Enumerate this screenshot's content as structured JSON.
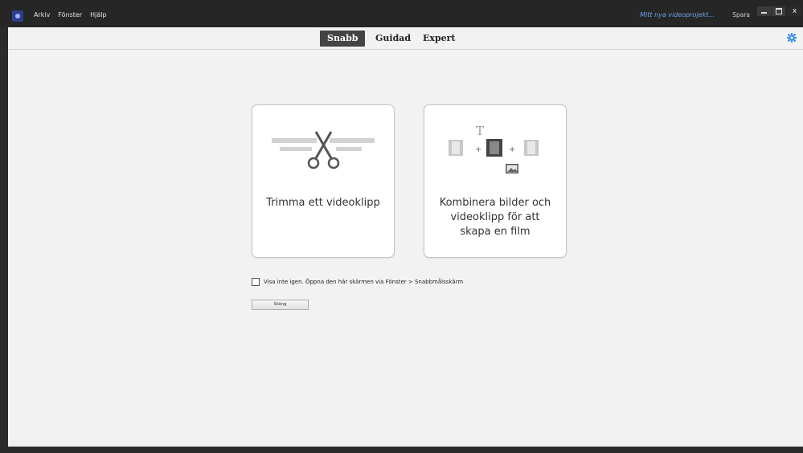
{
  "menu": {
    "items": [
      "Arkiv",
      "Fönster",
      "Hjälp"
    ]
  },
  "project": {
    "name": "Mitt nya videoprojekt...",
    "save_label": "Spara"
  },
  "window_controls": {
    "close_glyph": "x"
  },
  "tabs": [
    {
      "label": "Snabb",
      "active": true
    },
    {
      "label": "Guidad",
      "active": false
    },
    {
      "label": "Expert",
      "active": false
    }
  ],
  "cards": {
    "trim": {
      "label": "Trimma ett videoklipp",
      "icon": "scissors-icon"
    },
    "combine": {
      "label": "Kombinera bilder och videoklipp för att skapa en film",
      "icon": "film-combine-icon",
      "text_glyph": "T"
    }
  },
  "footer": {
    "checkbox_label": "Visa inte igen. Öppna den här skärmen via Fönster > Snabbmålsskärm",
    "checkbox_checked": false,
    "close_label": "Stäng"
  },
  "colors": {
    "accent": "#6aa3e8",
    "active_tab": "#444444",
    "gear": "#3a8ee6"
  }
}
